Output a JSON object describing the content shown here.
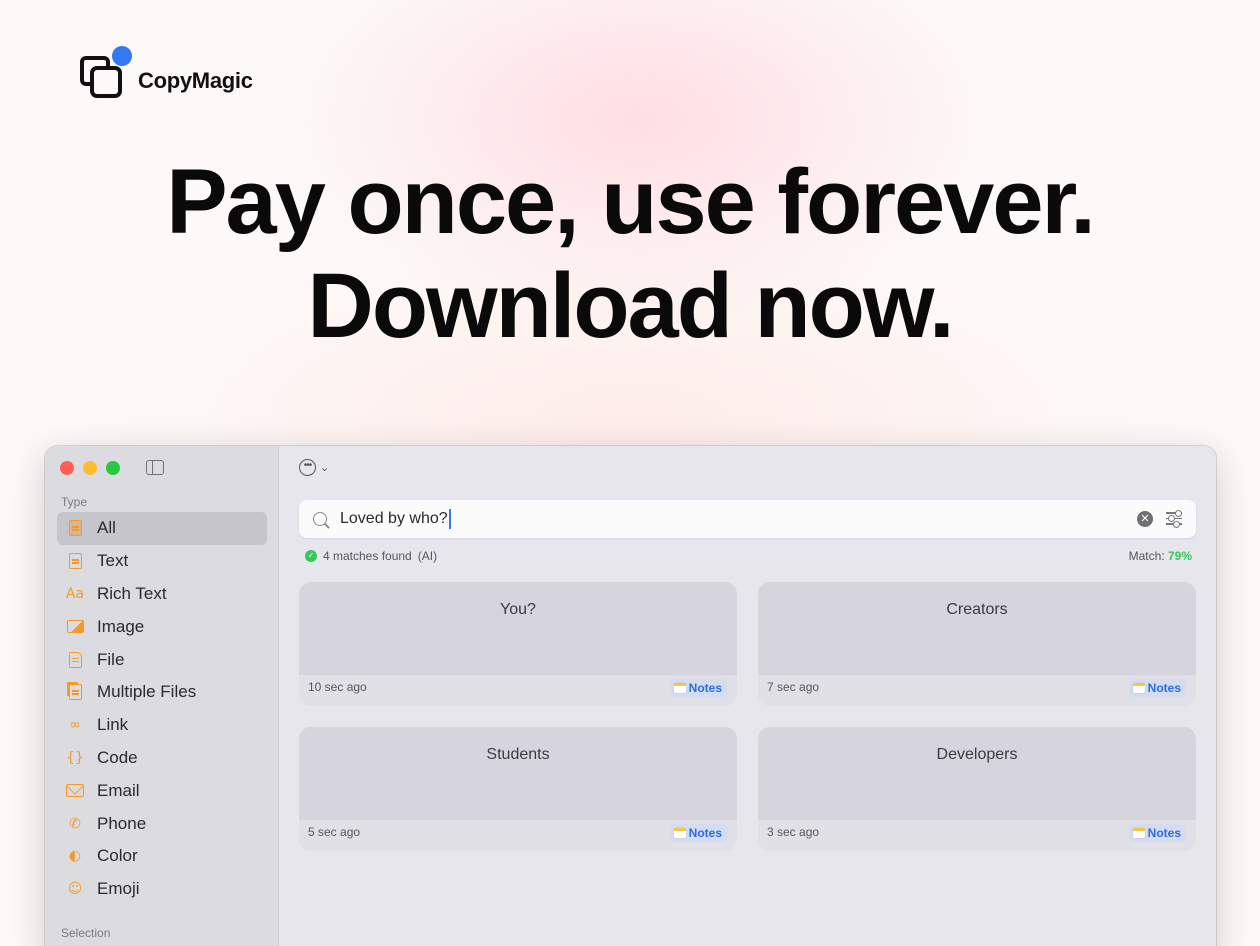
{
  "brand": {
    "name": "CopyMagic",
    "accent": "#3478f6"
  },
  "headline": {
    "line1": "Pay once, use forever.",
    "line2": "Download now."
  },
  "window": {
    "sidebar": {
      "type_label": "Type",
      "items": [
        {
          "label": "All",
          "icon": "all-icon",
          "active": true
        },
        {
          "label": "Text",
          "icon": "text-icon"
        },
        {
          "label": "Rich Text",
          "icon": "rich-text-icon"
        },
        {
          "label": "Image",
          "icon": "image-icon"
        },
        {
          "label": "File",
          "icon": "file-icon"
        },
        {
          "label": "Multiple Files",
          "icon": "multiple-files-icon"
        },
        {
          "label": "Link",
          "icon": "link-icon"
        },
        {
          "label": "Code",
          "icon": "code-icon"
        },
        {
          "label": "Email",
          "icon": "email-icon"
        },
        {
          "label": "Phone",
          "icon": "phone-icon"
        },
        {
          "label": "Color",
          "icon": "color-icon"
        },
        {
          "label": "Emoji",
          "icon": "emoji-icon"
        }
      ],
      "selection_label": "Selection"
    },
    "search": {
      "value": "Loved by who?"
    },
    "status": {
      "matches": "4 matches found",
      "mode": "(AI)",
      "match_label": "Match:",
      "match_value": "79%"
    },
    "cards": [
      {
        "title": "You?",
        "time": "10 sec ago",
        "source": "Notes"
      },
      {
        "title": "Creators",
        "time": "7 sec ago",
        "source": "Notes"
      },
      {
        "title": "Students",
        "time": "5 sec ago",
        "source": "Notes"
      },
      {
        "title": "Developers",
        "time": "3 sec ago",
        "source": "Notes"
      }
    ]
  }
}
